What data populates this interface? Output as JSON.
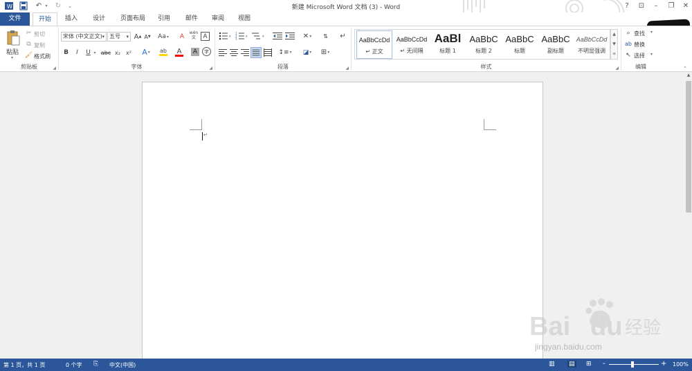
{
  "title": "新建 Microsoft Word 文档 (3) - Word",
  "quick_access": {
    "save_icon": "save-icon",
    "undo_icon": "undo-icon",
    "redo_icon": "redo-icon",
    "customize_icon": "chevron-down-icon"
  },
  "window_controls": {
    "help": "?",
    "restore_ribbon": "⊡",
    "minimize": "–",
    "restore": "❐",
    "close": "✕"
  },
  "tabs": [
    {
      "label": "文件"
    },
    {
      "label": "开始"
    },
    {
      "label": "插入"
    },
    {
      "label": "设计"
    },
    {
      "label": "页面布局"
    },
    {
      "label": "引用"
    },
    {
      "label": "邮件"
    },
    {
      "label": "审阅"
    },
    {
      "label": "视图"
    }
  ],
  "clipboard": {
    "paste": "粘贴",
    "cut": "剪切",
    "copy": "复制",
    "format_painter": "格式刷",
    "group_label": "剪贴板"
  },
  "font": {
    "name": "宋体 (中文正文)",
    "size": "五号",
    "grow": "A",
    "shrink": "A",
    "case": "Aa",
    "clear": "A",
    "pinyin_top": "wén",
    "pinyin_bottom": "文",
    "border": "A",
    "bold": "B",
    "italic": "I",
    "underline": "U",
    "strike": "abc",
    "subscript": "x₂",
    "superscript": "x²",
    "effects": "A",
    "highlight": "ab",
    "color": "A",
    "shade": "A",
    "circle": "字",
    "group_label": "字体"
  },
  "paragraph": {
    "group_label": "段落"
  },
  "styles": {
    "items": [
      {
        "preview": "AaBbCcDd",
        "name": "↵ 正文"
      },
      {
        "preview": "AaBbCcDd",
        "name": "↵ 无间隔"
      },
      {
        "preview": "AaBl",
        "name": "标题 1"
      },
      {
        "preview": "AaBbC",
        "name": "标题 2"
      },
      {
        "preview": "AaBbC",
        "name": "标题"
      },
      {
        "preview": "AaBbC",
        "name": "副标题"
      },
      {
        "preview": "AaBbCcDd",
        "name": "不明显强调"
      }
    ],
    "group_label": "样式"
  },
  "editing": {
    "find": "查找",
    "replace": "替换",
    "select": "选择",
    "group_label": "编辑"
  },
  "document": {
    "paragraph_mark": "↵"
  },
  "watermark": {
    "brand": "Bai",
    "brand2": "du",
    "cn": "经验",
    "url": "jingyan.baidu.com"
  },
  "status": {
    "page": "第 1 页，共 1 页",
    "words": "0 个字",
    "language": "中文(中国)",
    "zoom": "100%",
    "zoom_minus": "-",
    "zoom_plus": "+"
  },
  "colors": {
    "accent": "#2b579a",
    "highlight": "#ffd400",
    "font_color": "#ff0000"
  }
}
